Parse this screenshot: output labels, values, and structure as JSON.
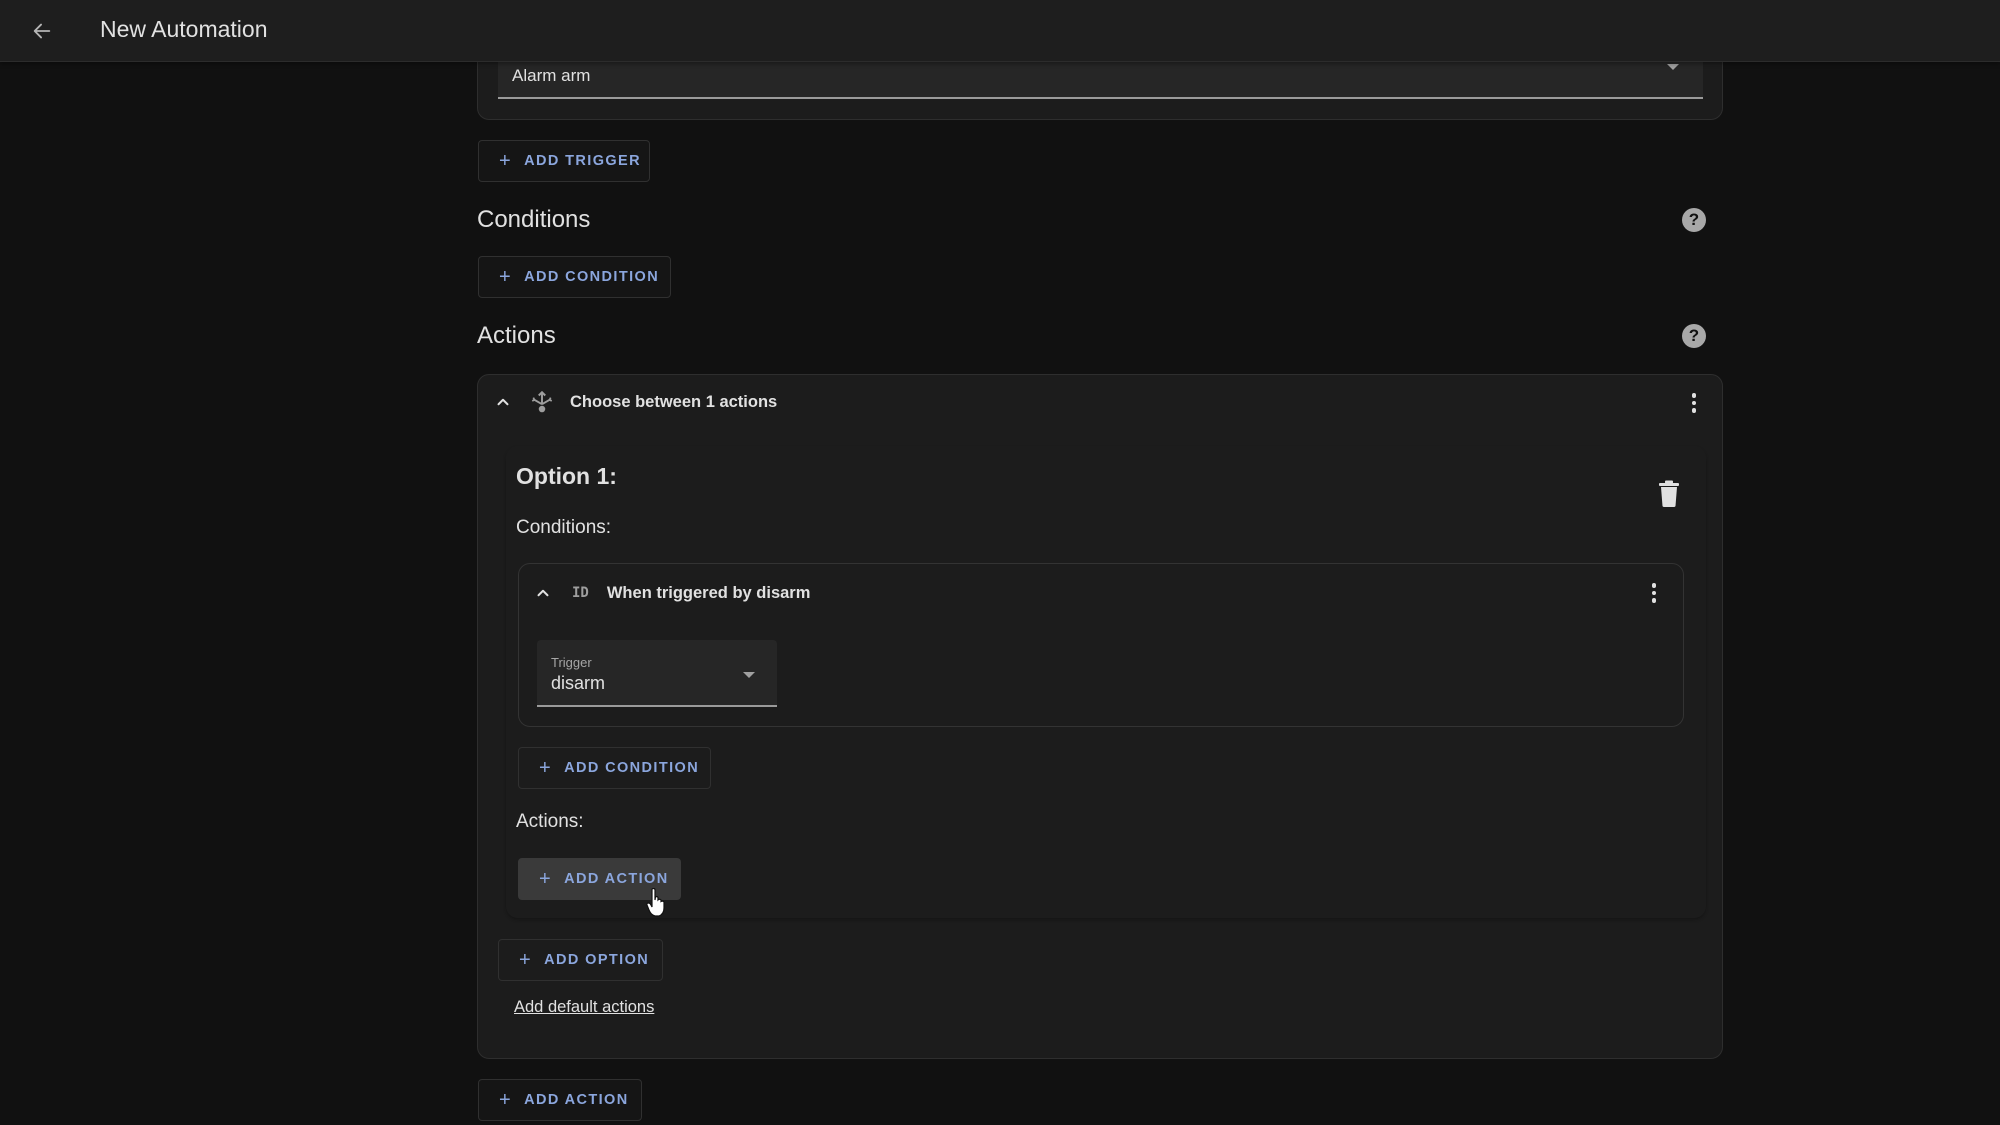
{
  "header": {
    "title": "New Automation",
    "back_icon": "arrow-left-icon"
  },
  "triggers": {
    "current_trigger_value": "Alarm arm",
    "add_trigger_label": "ADD TRIGGER"
  },
  "conditions": {
    "heading": "Conditions",
    "add_condition_label": "ADD CONDITION",
    "help_icon": "help-circle-icon"
  },
  "actions": {
    "heading": "Actions",
    "help_icon": "help-circle-icon",
    "add_action_label": "ADD ACTION",
    "items": [
      {
        "title": "Choose between 1 actions",
        "icon": "choose-arrows-icon",
        "options": [
          {
            "title": "Option 1:",
            "conditions_label": "Conditions:",
            "conditions": [
              {
                "icon_text": "ID",
                "title": "When triggered by disarm",
                "field_label": "Trigger",
                "field_value": "disarm"
              }
            ],
            "add_condition_label": "ADD CONDITION",
            "actions_label": "Actions:",
            "add_action_label": "ADD ACTION"
          }
        ],
        "add_option_label": "ADD OPTION",
        "add_default_actions_label": "Add default actions"
      }
    ]
  },
  "colors": {
    "accent": "#8ba6dd",
    "background": "#111111",
    "card": "#1c1c1c",
    "header": "#1e1e1e"
  }
}
